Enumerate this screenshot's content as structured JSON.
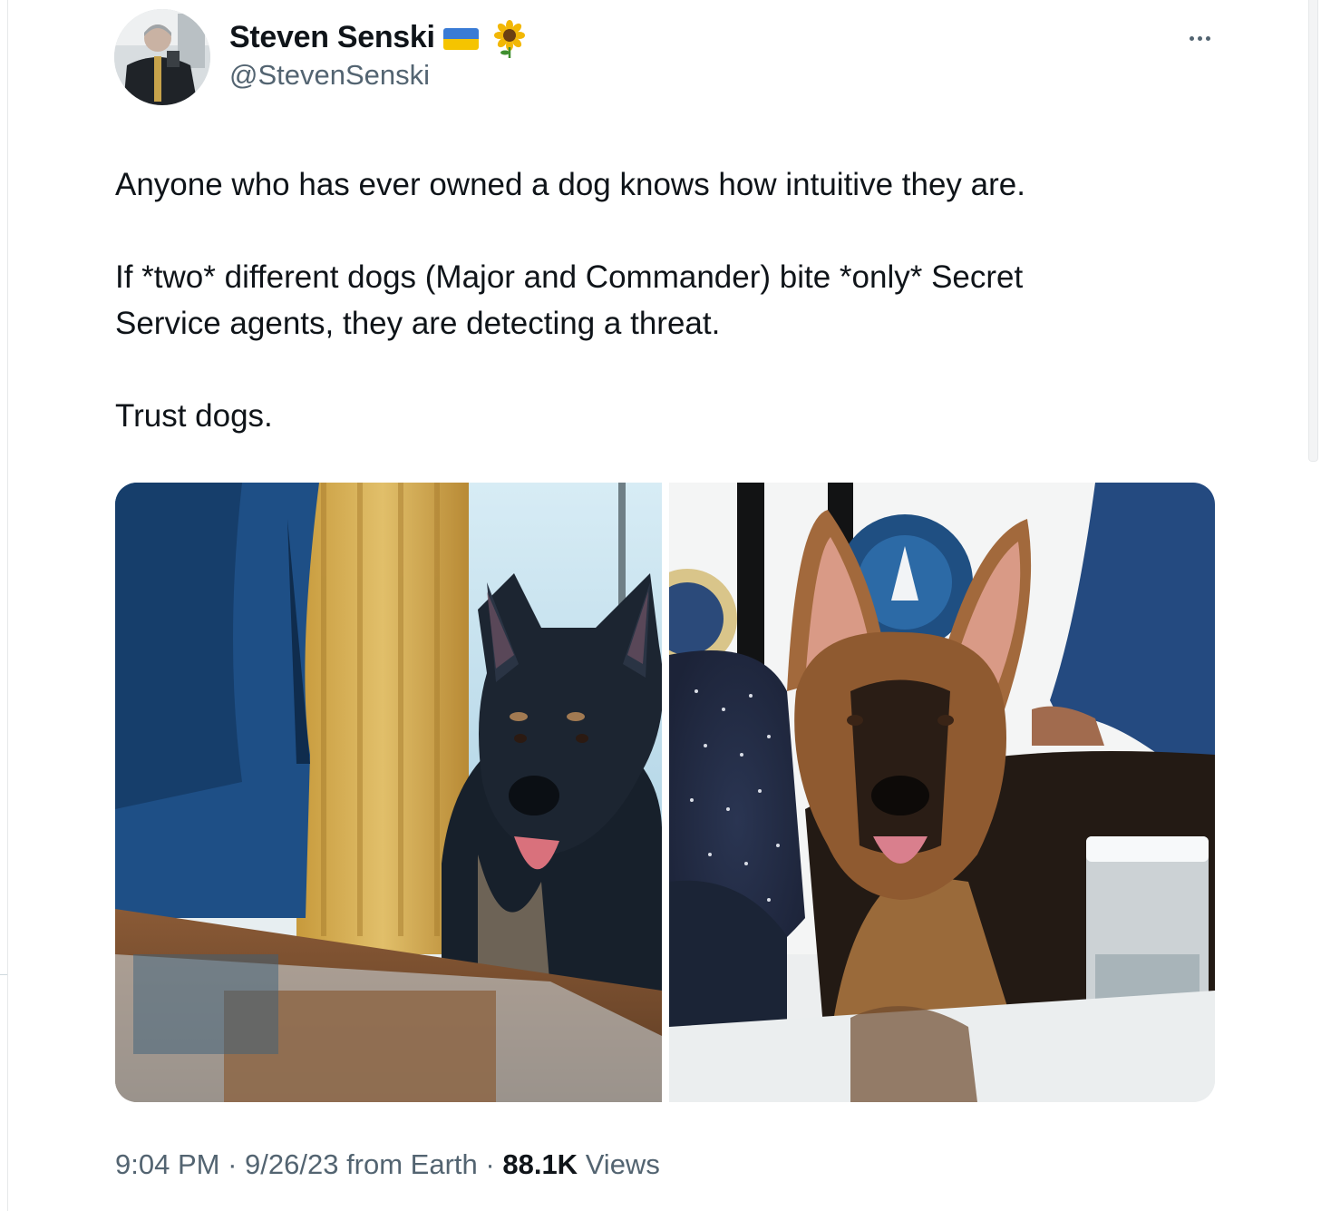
{
  "tweet": {
    "author": {
      "display_name": "Steven Senski",
      "handle": "@StevenSenski",
      "emoji_flag": "ukraine-flag",
      "emoji_flower": "sunflower"
    },
    "more_icon": "more-horizontal-icon",
    "text": {
      "line1": "Anyone who has ever owned a dog knows how intuitive they are.",
      "line2": "If *two* different dogs (Major and Commander) bite *only* Secret",
      "line3": "Service agents, they are detecting a threat.",
      "line4": "Trust dogs."
    },
    "meta": {
      "time": "9:04 PM",
      "sep1": " · ",
      "date": "9/26/23",
      "source": " from Earth",
      "sep2": " · ",
      "views_count": "88.1K",
      "views_label": " Views"
    }
  },
  "colors": {
    "text_primary": "#0f1419",
    "text_secondary": "#536471",
    "flag_blue": "#3a7bd5",
    "flag_yellow": "#f5c400"
  }
}
